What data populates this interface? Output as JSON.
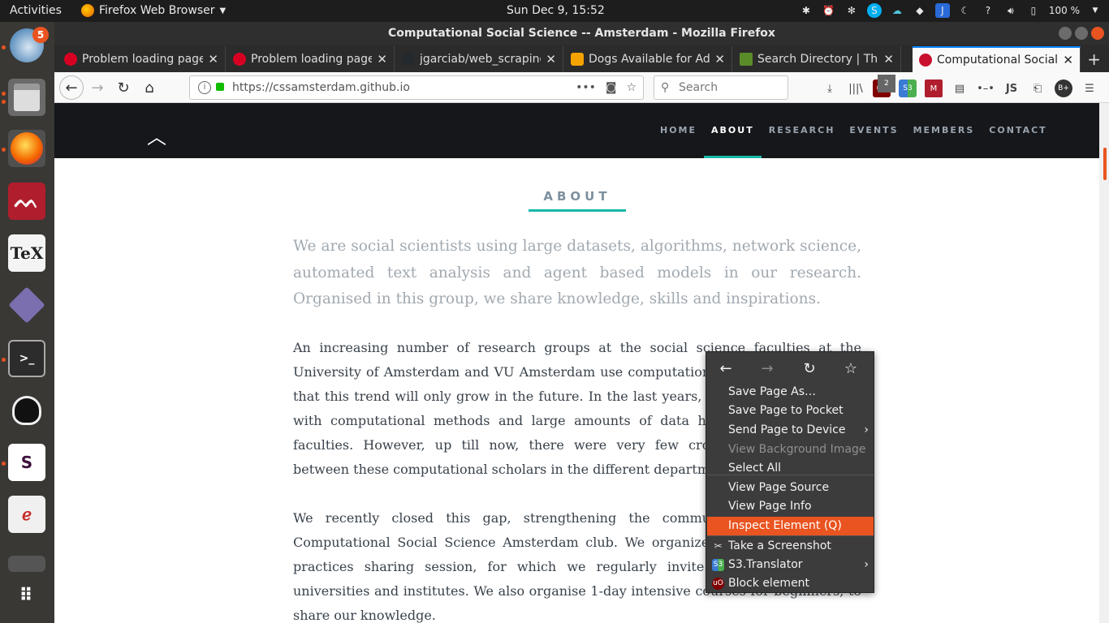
{
  "topbar": {
    "activities": "Activities",
    "app_menu": "Firefox Web Browser",
    "clock": "Sun Dec  9, 15:52",
    "battery": "100 %",
    "help": "?"
  },
  "dock": {
    "thunderbird_badge": "5",
    "tex_label": "TeX",
    "slack_label": "S"
  },
  "window": {
    "title": "Computational Social Science -- Amsterdam - Mozilla Firefox"
  },
  "tabs": [
    {
      "label": "Problem loading page",
      "icon": "error-icon",
      "color": "#d70022"
    },
    {
      "label": "Problem loading page",
      "icon": "error-icon",
      "color": "#d70022"
    },
    {
      "label": "jgarciab/web_scraping",
      "icon": "github-icon",
      "color": "#24292e"
    },
    {
      "label": "Dogs Available for Ado",
      "icon": "paw-icon",
      "color": "#f4a300"
    },
    {
      "label": "Search Directory | The",
      "icon": "v-icon",
      "color": "#5b8c2a"
    },
    {
      "label": "Computational Social S",
      "icon": "site-icon",
      "color": "#c8102e"
    }
  ],
  "new_tab": "+",
  "navbar": {
    "url": "https://cssamsterdam.github.io",
    "url_dots": "•••",
    "search_placeholder": "Search",
    "ublock_count": "2",
    "js_label": "JS"
  },
  "site": {
    "nav": [
      "HOME",
      "ABOUT",
      "RESEARCH",
      "EVENTS",
      "MEMBERS",
      "CONTACT"
    ],
    "active_nav": "ABOUT",
    "heading": "ABOUT",
    "lead": "We are social scientists using large datasets, algorithms, network science, automated text analysis and agent based models in our research. Organised in this group, we share knowledge, skills and inspirations.",
    "p1": "An increasing number of research groups at the social science faculties at the University of Amsterdam and VU Amsterdam use computational methods. We expect that this trend will only grow in the future. In the last years, many scholars working with computational methods and large amounts of data have emerged at these faculties. However, up till now, there were very few cross-faculty connections between these computational scholars in the different departments.",
    "p2": "We recently closed this gap, strengthening the community by forming the Computational Social Science Amsterdam club. We organize seminars with a best practices sharing session, for which we regularly invite speakers from other universities and institutes. We also organise 1-day intensive courses for beginners, to share our knowledge."
  },
  "context_menu": {
    "items": [
      {
        "label": "Save Page As…",
        "enabled": true
      },
      {
        "label": "Save Page to Pocket",
        "enabled": true
      },
      {
        "label": "Send Page to Device",
        "enabled": true,
        "submenu": true
      },
      {
        "label": "View Background Image",
        "enabled": false
      },
      {
        "label": "Select All",
        "enabled": true
      },
      {
        "label": "View Page Source",
        "enabled": true
      },
      {
        "label": "View Page Info",
        "enabled": true
      },
      {
        "label": "Inspect Element (Q)",
        "enabled": true,
        "highlighted": true
      },
      {
        "label": "Take a Screenshot",
        "enabled": true,
        "icon": "screenshot-icon"
      },
      {
        "label": "S3.Translator",
        "enabled": true,
        "submenu": true,
        "icon": "s3-translator-icon"
      },
      {
        "label": "Block element",
        "enabled": true,
        "icon": "ublock-icon"
      }
    ]
  },
  "colors": {
    "accent": "#e95420",
    "teal": "#18b7a8",
    "site_nav_bg": "#15171b"
  }
}
